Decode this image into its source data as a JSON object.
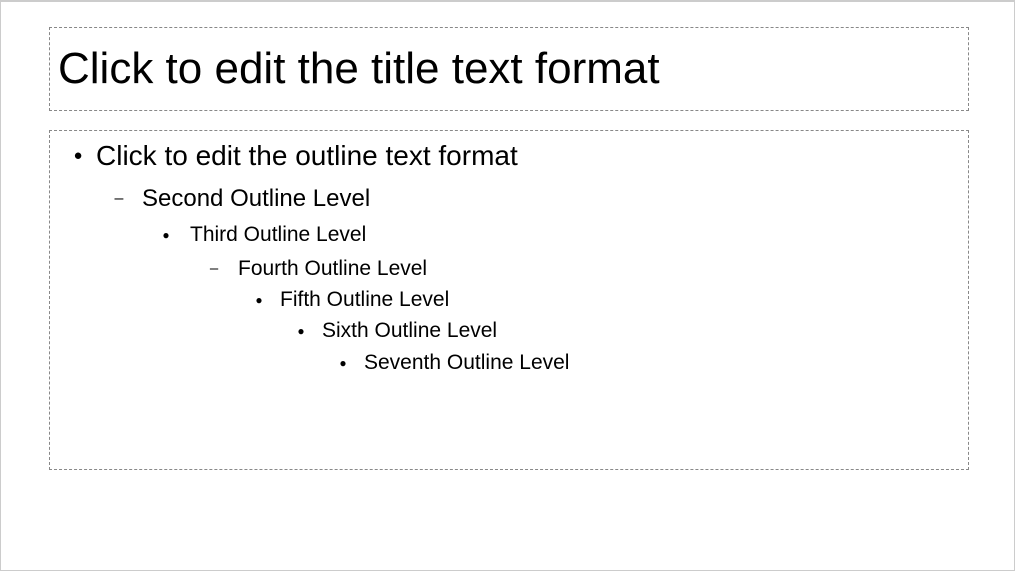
{
  "title": {
    "placeholder": "Click to edit the title text format"
  },
  "outline": {
    "levels": [
      {
        "bullet": "●",
        "text": "Click to edit the outline text format"
      },
      {
        "bullet": "–",
        "text": "Second Outline Level"
      },
      {
        "bullet": "●",
        "text": "Third Outline Level"
      },
      {
        "bullet": "–",
        "text": "Fourth Outline Level"
      },
      {
        "bullet": "●",
        "text": "Fifth Outline Level"
      },
      {
        "bullet": "●",
        "text": "Sixth Outline Level"
      },
      {
        "bullet": "●",
        "text": "Seventh Outline Level"
      }
    ]
  }
}
